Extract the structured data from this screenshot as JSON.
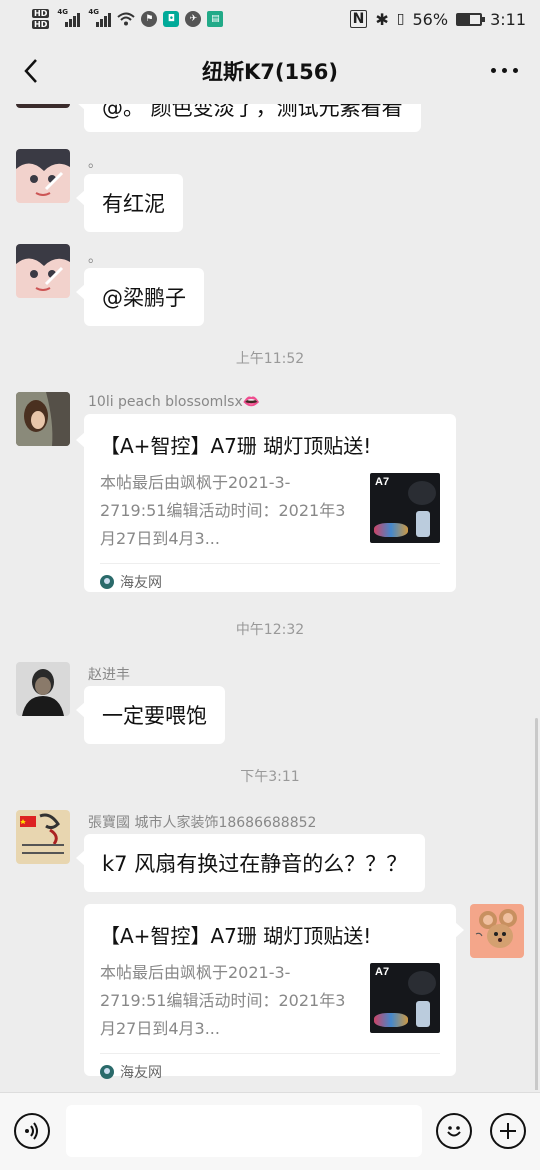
{
  "status_bar": {
    "hd1": "HD",
    "hd2": "HD",
    "net1": "4G",
    "net2": "4G",
    "battery_percent": "56%",
    "battery_level": 0.56,
    "time": "3:11"
  },
  "header": {
    "title": "纽斯K7(156)"
  },
  "messages": {
    "m0": {
      "text": "@。 颜色变淡了，测试元素看看"
    },
    "m1": {
      "sender": "。",
      "text": "有红泥"
    },
    "m2": {
      "sender": "。",
      "text": "@梁鹏子"
    },
    "t1": "上午11:52",
    "m3": {
      "sender": "10li peach blossomlsx👄",
      "card_title": "【A+智控】A7珊 瑚灯顶贴送!",
      "card_desc": "本帖最后由飒枫于2021-3-2719:51编辑活动时间：2021年3月27日到4月3...",
      "thumb_text": "A7",
      "source": "海友网"
    },
    "t2": "中午12:32",
    "m4": {
      "sender": "赵进丰",
      "text": "一定要喂饱"
    },
    "t3": "下午3:11",
    "m5": {
      "sender": "張寶國 城市人家装饰18686688852",
      "text": "k7 风扇有换过在静音的么？？？"
    },
    "m6": {
      "card_title": "【A+智控】A7珊 瑚灯顶贴送!",
      "card_desc": "本帖最后由飒枫于2021-3-2719:51编辑活动时间：2021年3月27日到4月3...",
      "thumb_text": "A7",
      "source": "海友网"
    }
  },
  "input_bar": {
    "placeholder": ""
  }
}
